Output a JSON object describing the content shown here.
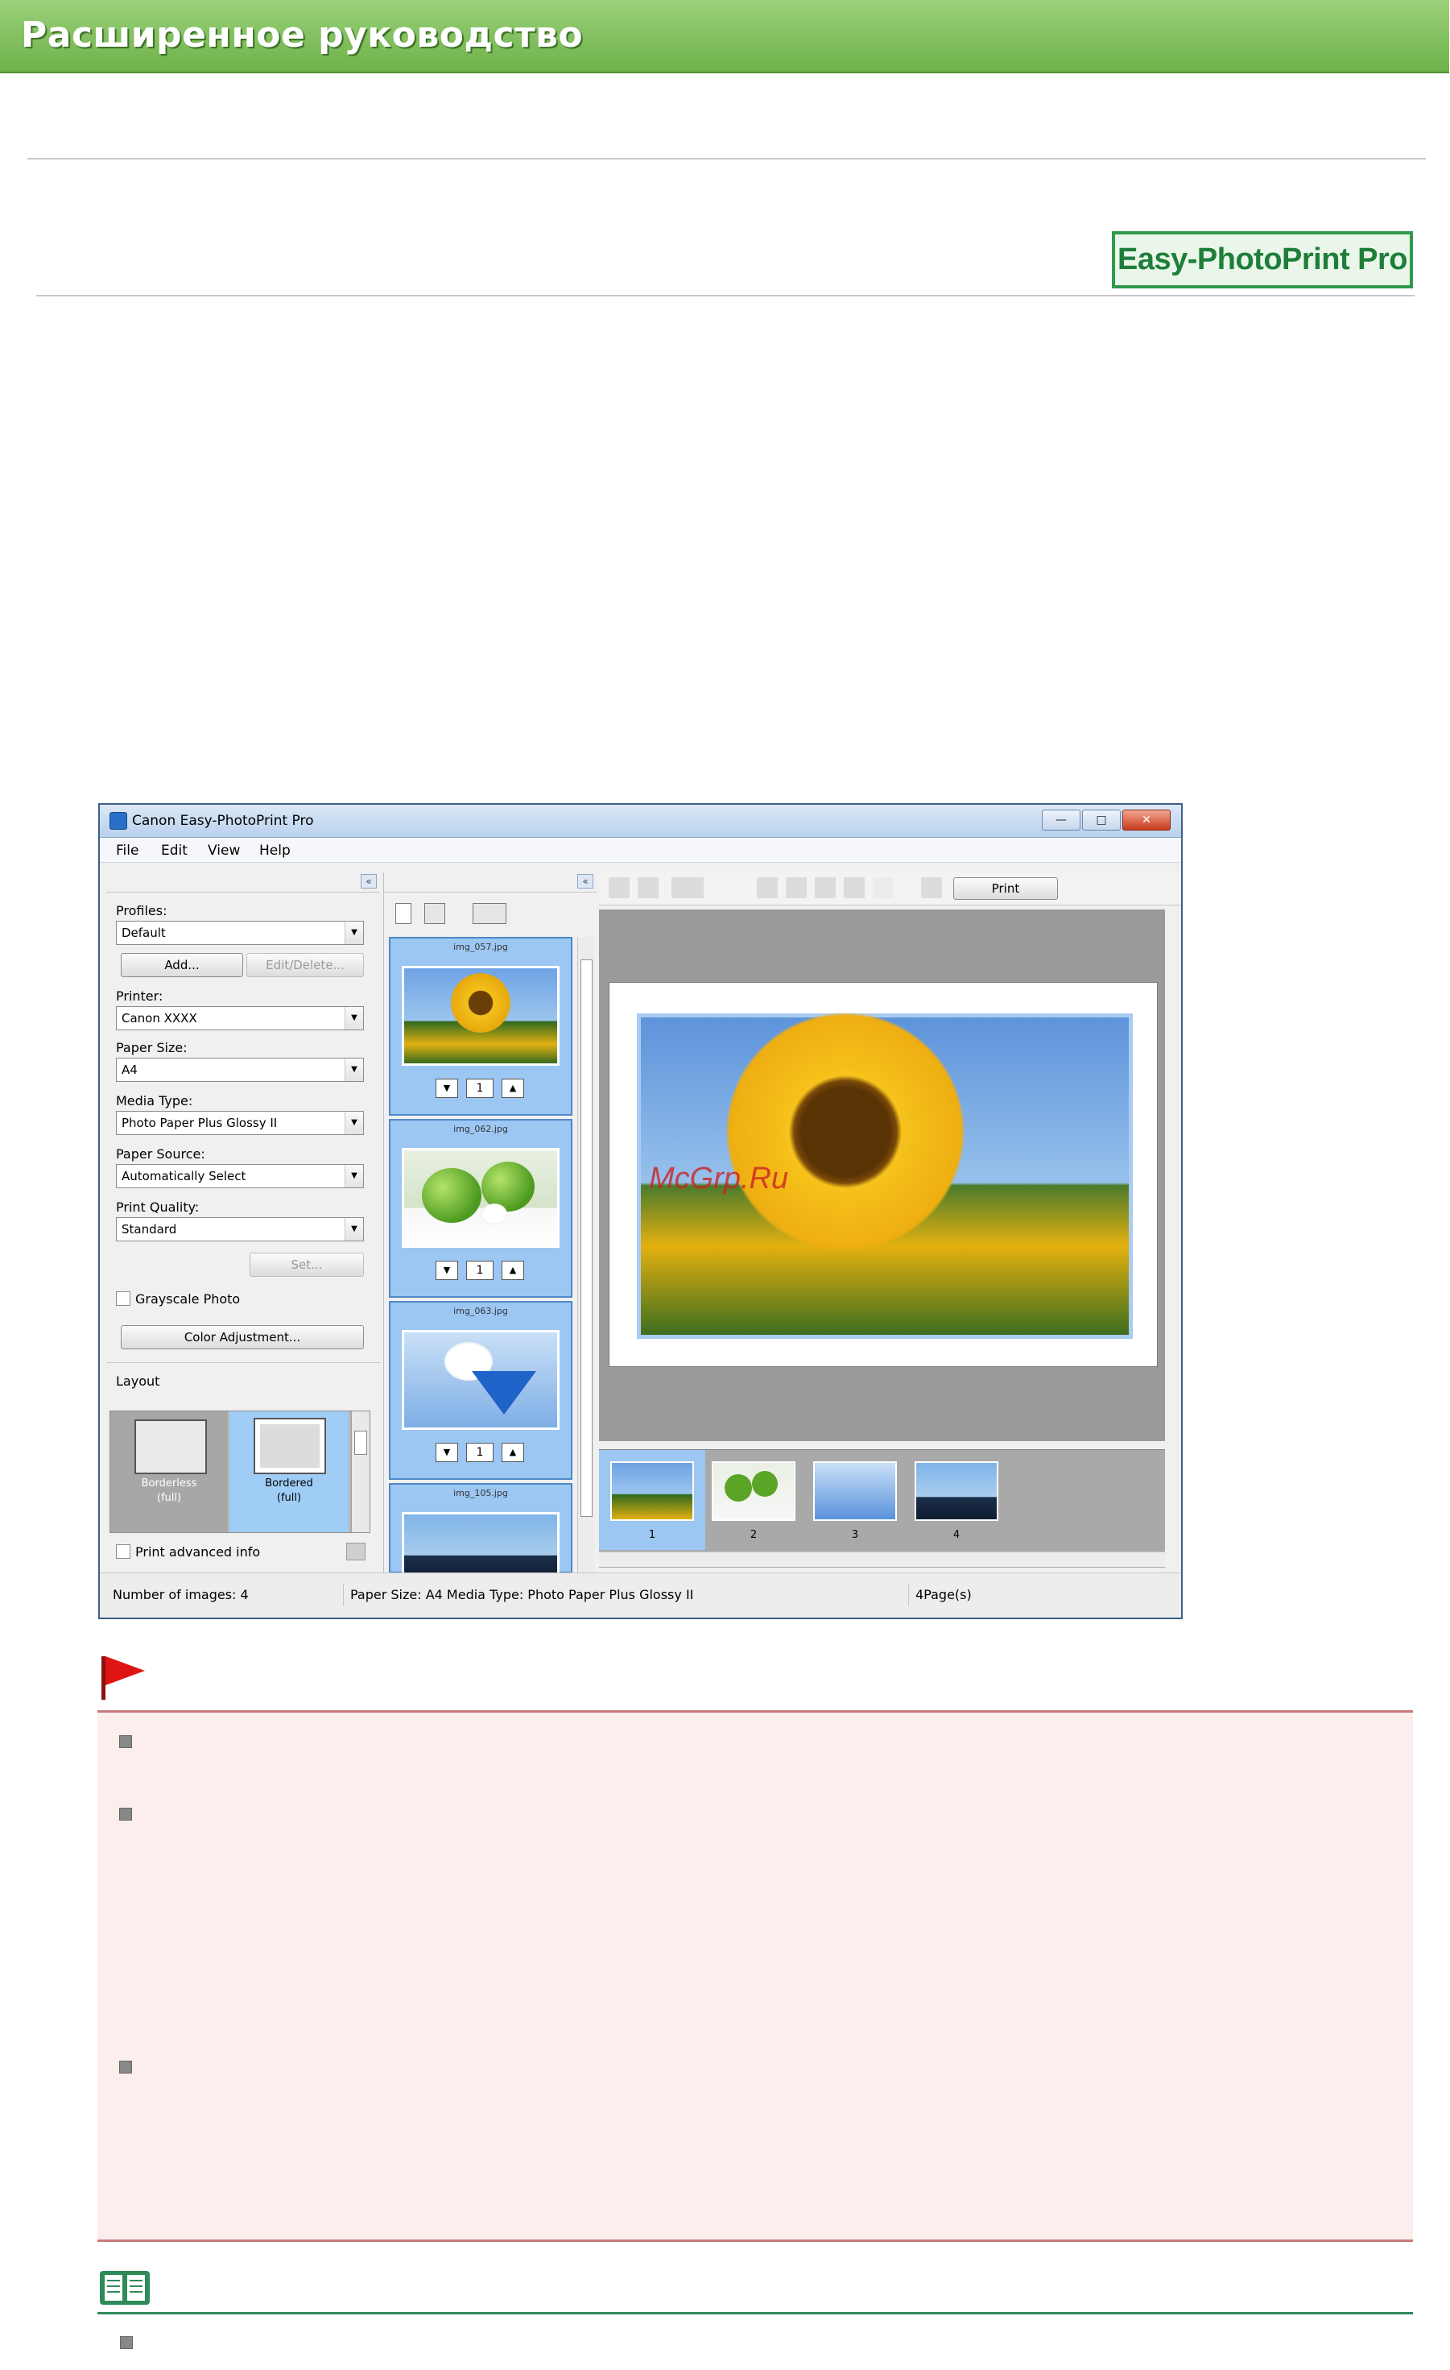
{
  "header": {
    "title": "Расширенное руководство"
  },
  "product_badge": {
    "label": "Easy-PhotoPrint Pro"
  },
  "window": {
    "title": "Canon Easy-PhotoPrint Pro",
    "controls": {
      "minimize": "—",
      "maximize": "□",
      "close": "✕"
    },
    "menu": [
      "File",
      "Edit",
      "View",
      "Help"
    ],
    "left_panel": {
      "collapse": "«",
      "profiles_label": "Profiles:",
      "profiles_value": "Default",
      "add_button": "Add...",
      "edit_delete_button": "Edit/Delete...",
      "printer_label": "Printer:",
      "printer_value": "Canon XXXX",
      "paper_size_label": "Paper Size:",
      "paper_size_value": "A4",
      "media_type_label": "Media Type:",
      "media_type_value": "Photo Paper Plus Glossy II",
      "paper_source_label": "Paper Source:",
      "paper_source_value": "Automatically Select",
      "print_quality_label": "Print Quality:",
      "print_quality_value": "Standard",
      "set_button": "Set...",
      "grayscale_label": "Grayscale Photo",
      "color_adjust_button": "Color Adjustment...",
      "layout_label": "Layout",
      "layouts": [
        {
          "line1": "Borderless",
          "line2": "(full)"
        },
        {
          "line1": "Bordered",
          "line2": "(full)"
        }
      ],
      "print_advanced_label": "Print advanced info"
    },
    "middle_panel": {
      "collapse": "«",
      "thumbnails": [
        {
          "filename": "img_057.jpg",
          "count": "1"
        },
        {
          "filename": "img_062.jpg",
          "count": "1"
        },
        {
          "filename": "img_063.jpg",
          "count": "1"
        },
        {
          "filename": "img_105.jpg"
        }
      ],
      "spin_down": "▼",
      "spin_up": "▲"
    },
    "right_panel": {
      "print_button": "Print",
      "pages": [
        "1",
        "2",
        "3",
        "4"
      ]
    },
    "status": {
      "images": "Number of images: 4",
      "paper": "Paper Size: A4  Media Type: Photo Paper Plus Glossy II",
      "pages": "4Page(s)"
    }
  },
  "watermark": "McGrp.Ru"
}
